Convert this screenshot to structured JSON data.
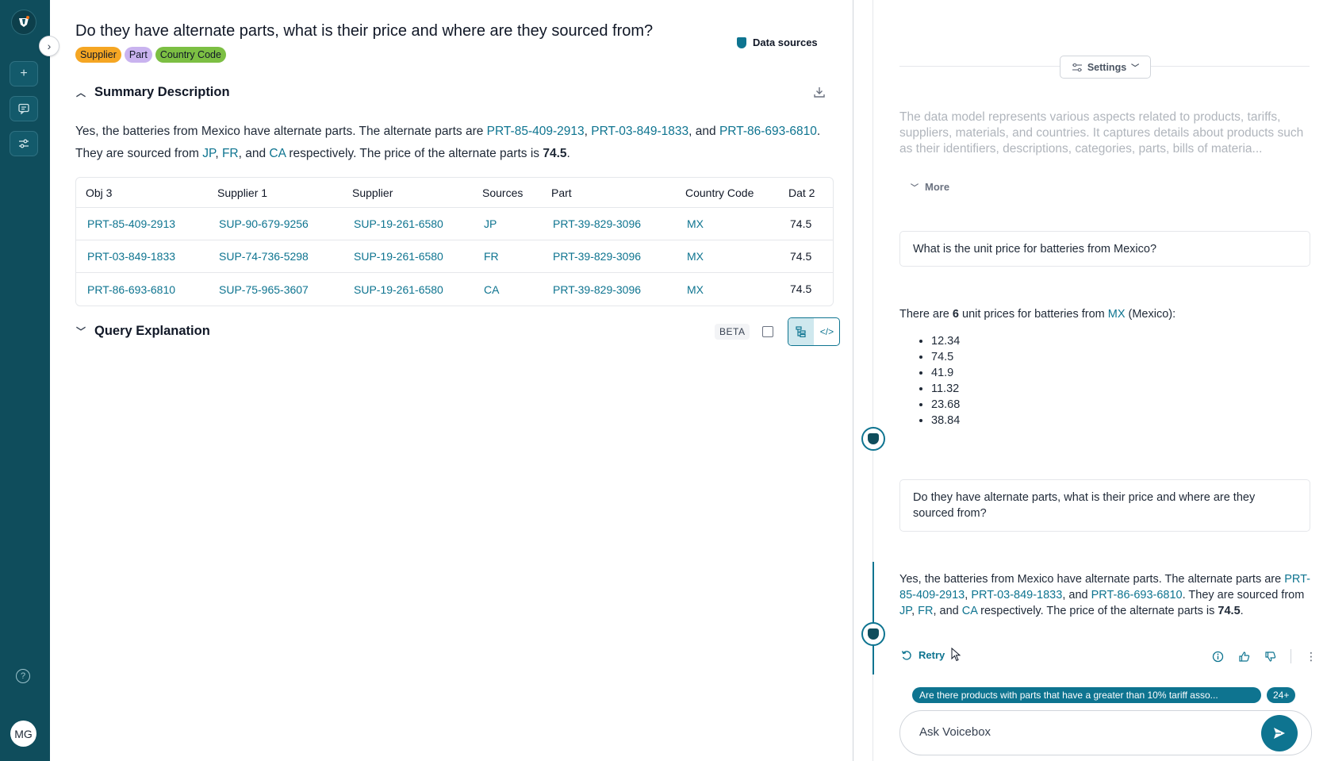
{
  "main": {
    "question_title": "Do they have alternate parts, what is their price and where are they sourced from?",
    "tags": [
      "Supplier",
      "Part",
      "Country Code"
    ],
    "data_sources_label": "Data sources",
    "summary_heading": "Summary Description",
    "summary": {
      "p1": "Yes, the batteries from Mexico have alternate parts. The alternate parts are ",
      "l1": "PRT-85-409-2913",
      "p2": ", ",
      "l2": "PRT-03-849-1833",
      "p3": ", and ",
      "l3": "PRT-86-693-6810",
      "p4": ". They are sourced from ",
      "c1": "JP",
      "p5": ", ",
      "c2": "FR",
      "p6": ", and ",
      "c3": "CA",
      "p7": " respectively. The price of the alternate parts is ",
      "price": "74.5",
      "p8": "."
    },
    "table": {
      "headers": [
        "Obj 3",
        "Supplier 1",
        "Supplier",
        "Sources",
        "Part",
        "Country Code",
        "Dat 2"
      ],
      "rows": [
        [
          "PRT-85-409-2913",
          "SUP-90-679-9256",
          "SUP-19-261-6580",
          "JP",
          "PRT-39-829-3096",
          "MX",
          "74.5"
        ],
        [
          "PRT-03-849-1833",
          "SUP-74-736-5298",
          "SUP-19-261-6580",
          "FR",
          "PRT-39-829-3096",
          "MX",
          "74.5"
        ],
        [
          "PRT-86-693-6810",
          "SUP-75-965-3607",
          "SUP-19-261-6580",
          "CA",
          "PRT-39-829-3096",
          "MX",
          "74.5"
        ]
      ]
    },
    "query_heading": "Query Explanation",
    "beta_label": "BETA"
  },
  "rail": {
    "avatar_initials": "MG"
  },
  "chat": {
    "settings_label": "Settings",
    "model_description": "The data model represents various aspects related to products, tariffs, suppliers, materials, and countries. It captures details about products such as their identifiers, descriptions, categories, parts, bills of materia...",
    "more_label": "More",
    "user_q1": "What is the unit price for batteries from Mexico?",
    "answer1": {
      "p1": "There are ",
      "count": "6",
      "p2": " unit prices for batteries from ",
      "country": "MX",
      "p3": " (Mexico):",
      "prices": [
        "12.34",
        "74.5",
        "41.9",
        "11.32",
        "23.68",
        "38.84"
      ]
    },
    "user_q2": "Do they have alternate parts, what is their price and where are they sourced from?",
    "answer2": {
      "p1": "Yes, the batteries from Mexico have alternate parts. The alternate parts are ",
      "l1": "PRT-85-409-2913",
      "p2": ", ",
      "l2": "PRT-03-849-1833",
      "p3": ", and ",
      "l3": "PRT-86-693-6810",
      "p4": ". They are sourced from ",
      "c1": "JP",
      "p5": ", ",
      "c2": "FR",
      "p6": ", and ",
      "c3": "CA",
      "p7": " respectively. The price of the alternate parts is ",
      "price": "74.5",
      "p8": "."
    },
    "retry_label": "Retry",
    "suggestion": "Are there products with parts that have a greater than 10% tariff asso...",
    "suggestion_count": "24+",
    "ask_placeholder": "Ask Voicebox"
  },
  "colors": {
    "rail": "#0f4d5c",
    "accent": "#0e7490",
    "tag_supplier": "#f5a623",
    "tag_part": "#c9b3ef",
    "tag_country": "#7cbf43"
  }
}
